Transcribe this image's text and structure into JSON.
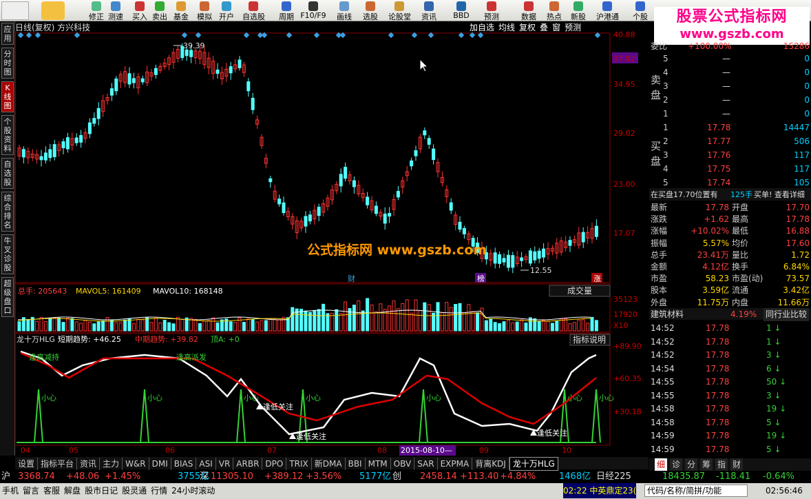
{
  "toolbar": {
    "items": [
      "修正",
      "测速",
      "买入",
      "卖出",
      "基金",
      "模拟",
      "开户",
      "自选股",
      "周期",
      "F10/F9",
      "画线",
      "选股",
      "论股堂",
      "资讯",
      "BBD",
      "预测",
      "数据",
      "热点",
      "新股",
      "沪港通",
      "个股"
    ]
  },
  "sidebar": {
    "items": [
      "应用",
      "分时图",
      "K线图",
      "个股资料",
      "自选股",
      "综合排名",
      "牛叉诊股",
      "超级盘口"
    ]
  },
  "stock": {
    "header": "日线(复权) 方兴科技",
    "buttons": [
      "加自选",
      "均线",
      "复权",
      "叠",
      "窗",
      "预测"
    ]
  },
  "price_axis": {
    "labels": [
      "40.88",
      "37.92",
      "34.95",
      "29.02",
      "23.00",
      "17.07"
    ],
    "highlight": "37.92"
  },
  "annotations": {
    "high": "39.39",
    "low": "12.55",
    "cai": "财",
    "bang": "榜",
    "zhang": "涨"
  },
  "volume": {
    "title": "总手: 205643",
    "mavol5": "MAVOL5: 161409",
    "mavol10": "MAVOL10: 168148",
    "dropdown": "成交量",
    "axis": [
      "35123",
      "17920",
      "X10"
    ]
  },
  "indicator": {
    "title": "龙十万HLG",
    "short": "短期趋势: +46.25",
    "mid": "中期趋势: +39.82",
    "top": "顶A: +0",
    "explain": "指标说明",
    "axis": [
      "+89.90",
      "+60.35",
      "+30.18"
    ],
    "labels": [
      "小心",
      "小心",
      "小心",
      "小心",
      "小心",
      "小心",
      "小心"
    ],
    "low_focus": "逢低关注",
    "break": "逢高减持",
    "break2": "逢高派发"
  },
  "xaxis": {
    "labels": [
      "04",
      "05",
      "06",
      "07",
      "08",
      "09",
      "10"
    ],
    "highlight": "2015-08-10—"
  },
  "watermark": "公式指标网  www.gszb.com",
  "logo": {
    "line1": "股票公式指标网",
    "line2": "www.gszb.com"
  },
  "orderbook": {
    "wei_bi": "委比",
    "wei_bi_val": "+100.00%",
    "wei_cha": "15286",
    "sell": [
      {
        "n": "5",
        "p": "—",
        "v": "0"
      },
      {
        "n": "4",
        "p": "—",
        "v": "0"
      },
      {
        "n": "3",
        "p": "—",
        "v": "0"
      },
      {
        "n": "2",
        "p": "—",
        "v": "0"
      },
      {
        "n": "1",
        "p": "—",
        "v": "0"
      }
    ],
    "buy": [
      {
        "n": "1",
        "p": "17.78",
        "v": "14447"
      },
      {
        "n": "2",
        "p": "17.77",
        "v": "506"
      },
      {
        "n": "3",
        "p": "17.76",
        "v": "117"
      },
      {
        "n": "4",
        "p": "17.75",
        "v": "117"
      },
      {
        "n": "5",
        "p": "17.74",
        "v": "105"
      }
    ],
    "sell_label": "卖盘",
    "buy_label": "买盘",
    "note": "在买盘17.70位置有",
    "note2": "125手",
    "note3": "买单! 查看详细"
  },
  "quote": [
    [
      "最新",
      "17.78",
      "开盘",
      "17.70"
    ],
    [
      "涨跌",
      "+1.62",
      "最高",
      "17.78"
    ],
    [
      "涨幅",
      "+10.02%",
      "最低",
      "16.88"
    ],
    [
      "振幅",
      "5.57%",
      "均价",
      "17.60"
    ],
    [
      "总手",
      "23.41万",
      "量比",
      "1.72"
    ],
    [
      "金额",
      "4.12亿",
      "换手",
      "6.84%"
    ],
    [
      "市盈",
      "58.23",
      "市盈(动)",
      "73.57"
    ],
    [
      "股本",
      "3.59亿",
      "流通",
      "3.42亿"
    ],
    [
      "外盘",
      "11.75万",
      "内盘",
      "11.66万"
    ]
  ],
  "industry": {
    "name": "建筑材料",
    "pct": "4.19%",
    "compare": "同行业比较"
  },
  "ticks": [
    [
      "14:52",
      "17.78",
      "1"
    ],
    [
      "14:52",
      "17.78",
      "1"
    ],
    [
      "14:52",
      "17.78",
      "3"
    ],
    [
      "14:54",
      "17.78",
      "6"
    ],
    [
      "14:55",
      "17.78",
      "50"
    ],
    [
      "14:55",
      "17.78",
      "3"
    ],
    [
      "14:58",
      "17.78",
      "19"
    ],
    [
      "14:58",
      "17.78",
      "5"
    ],
    [
      "14:59",
      "17.78",
      "19"
    ],
    [
      "14:59",
      "17.78",
      "5"
    ]
  ],
  "rtabs": [
    "细",
    "诊",
    "分",
    "筹",
    "指",
    "财"
  ],
  "bottom_tabs": [
    "设置",
    "指标平台",
    "资讯",
    "主力",
    "W&R",
    "DMI",
    "BIAS",
    "ASI",
    "VR",
    "ARBR",
    "DPO",
    "TRIX",
    "新DMA",
    "BBI",
    "MTM",
    "OBV",
    "SAR",
    "EXPMA",
    "背离KDJ",
    "龙十万HLG"
  ],
  "ticker": {
    "sh": "沪",
    "sh_val": "3368.74",
    "sh_chg": "+48.06",
    "sh_pct": "+1.45%",
    "sh_amt": "3755亿",
    "sz": "深",
    "sz_val": "11305.10",
    "sz_chg": "+389.12",
    "sz_pct": "+3.56%",
    "cy_amt": "5177亿",
    "cy": "创",
    "cy_val": "2458.14",
    "cy_chg": "+113.40",
    "cy_pct": "+4.84%",
    "nk_amt": "1468亿",
    "nk": "日经225",
    "nk_val": "18435.87",
    "nk_chg": "-118.41",
    "nk_pct": "-0.64%"
  },
  "status": {
    "items": [
      "手机",
      "留言",
      "客服",
      "解盘",
      "股市日记",
      "股灵通",
      "行情",
      "24小时滚动"
    ],
    "time1": "02:22",
    "news": "中英鼎定23(",
    "search": "代码/名称/简拼/功能",
    "time2": "02:56:46"
  },
  "colors": {
    "up": "#ff3232",
    "down": "#54ffff",
    "axis": "#c00000"
  }
}
